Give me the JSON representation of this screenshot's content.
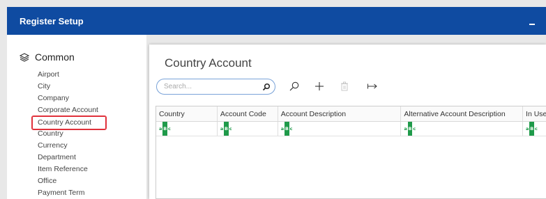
{
  "window": {
    "title": "Register Setup",
    "minimize_label": "–"
  },
  "sidebar": {
    "section_title": "Common",
    "items": [
      {
        "label": "Airport"
      },
      {
        "label": "City"
      },
      {
        "label": "Company"
      },
      {
        "label": "Corporate Account"
      },
      {
        "label": "Country Account",
        "selected": true
      },
      {
        "label": "Country"
      },
      {
        "label": "Currency"
      },
      {
        "label": "Department"
      },
      {
        "label": "Item Reference"
      },
      {
        "label": "Office"
      },
      {
        "label": "Payment Term"
      }
    ]
  },
  "panel": {
    "title": "Country Account",
    "search": {
      "placeholder": "Search...",
      "value": ""
    },
    "toolbar": [
      {
        "icon": "search-icon"
      },
      {
        "icon": "plus-icon"
      },
      {
        "icon": "trash-icon",
        "disabled": true
      },
      {
        "icon": "arrow-right-icon"
      }
    ]
  },
  "grid": {
    "columns": [
      {
        "label": "Country"
      },
      {
        "label": "Account Code"
      },
      {
        "label": "Account Description"
      },
      {
        "label": "Alternative Account Description"
      },
      {
        "label": "In Use"
      }
    ],
    "filter_icon": "abc-filter-icon"
  },
  "colors": {
    "titlebar": "#0f4ba1",
    "selection_outline": "#e0303a",
    "filter_icon": "#1f9a4a"
  }
}
